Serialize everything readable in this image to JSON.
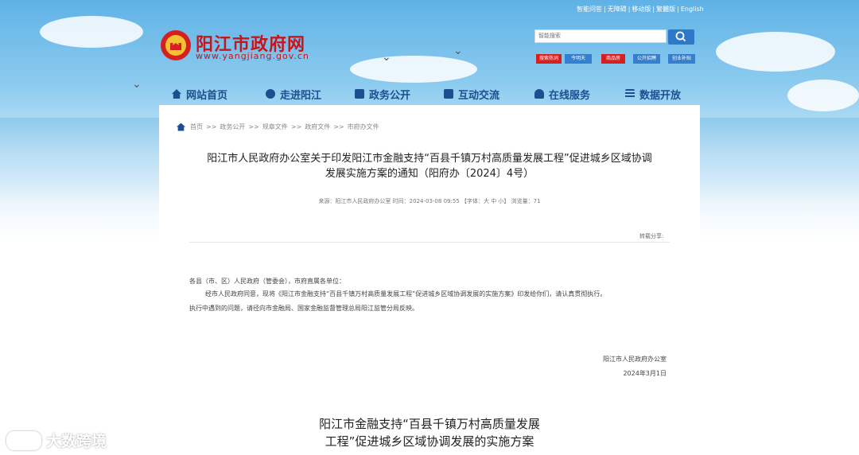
{
  "topbar": {
    "links": [
      "智能问答",
      "无障碍",
      "移动版",
      "繁體版",
      "English"
    ],
    "separator": "|"
  },
  "site": {
    "name": "阳江市政府网",
    "domain": "www.yangjiang.gov.cn"
  },
  "search": {
    "placeholder": "智能搜索",
    "hot_tags": [
      "搜索热词",
      "今明天",
      "商品房",
      "公开招聘",
      "创业补贴"
    ]
  },
  "nav": {
    "items": [
      {
        "label": "网站首页",
        "icon": "home-icon"
      },
      {
        "label": "走进阳江",
        "icon": "bird-icon"
      },
      {
        "label": "政务公开",
        "icon": "document-icon"
      },
      {
        "label": "互动交流",
        "icon": "book-icon"
      },
      {
        "label": "在线服务",
        "icon": "people-icon"
      },
      {
        "label": "数据开放",
        "icon": "list-icon"
      }
    ]
  },
  "breadcrumb": {
    "items": [
      "首页",
      "政务公开",
      "规章文件",
      "政府文件",
      "市府办文件"
    ],
    "separator": ">>"
  },
  "article": {
    "title_line1": "阳江市人民政府办公室关于印发阳江市金融支持“百县千镇万村高质量发展工程”促进城乡区域协调",
    "title_line2": "发展实施方案的通知（阳府办〔2024〕4号）",
    "meta": "来源：阳江市人民政府办公室 时间：2024-03-08 09:55 【字体：大 中 小】 浏览量：71",
    "share_label": "转载分享:",
    "greeting": "各县（市、区）人民政府（管委会），市府直属各单位：",
    "para1": "经市人民政府同意，现将《阳江市金融支持“百县千镇万村高质量发展工程”促进城乡区域协调发展的实施方案》印发给你们，请认真贯彻执行。",
    "para2": "执行中遇到的问题，请径向市金融局、国家金融监督管理总局阳江监管分局反映。",
    "signature": "阳江市人民政府办公室",
    "date": "2024年3月1日",
    "subtitle_line1": "阳江市金融支持“百县千镇万村高质量发展",
    "subtitle_line2": "工程”促进城乡区域协调发展的实施方案"
  },
  "watermark": {
    "text": "大数跨境"
  },
  "colors": {
    "brand_red": "#c3171c",
    "nav_blue": "#1b4f8f",
    "search_blue": "#2e78c8"
  }
}
